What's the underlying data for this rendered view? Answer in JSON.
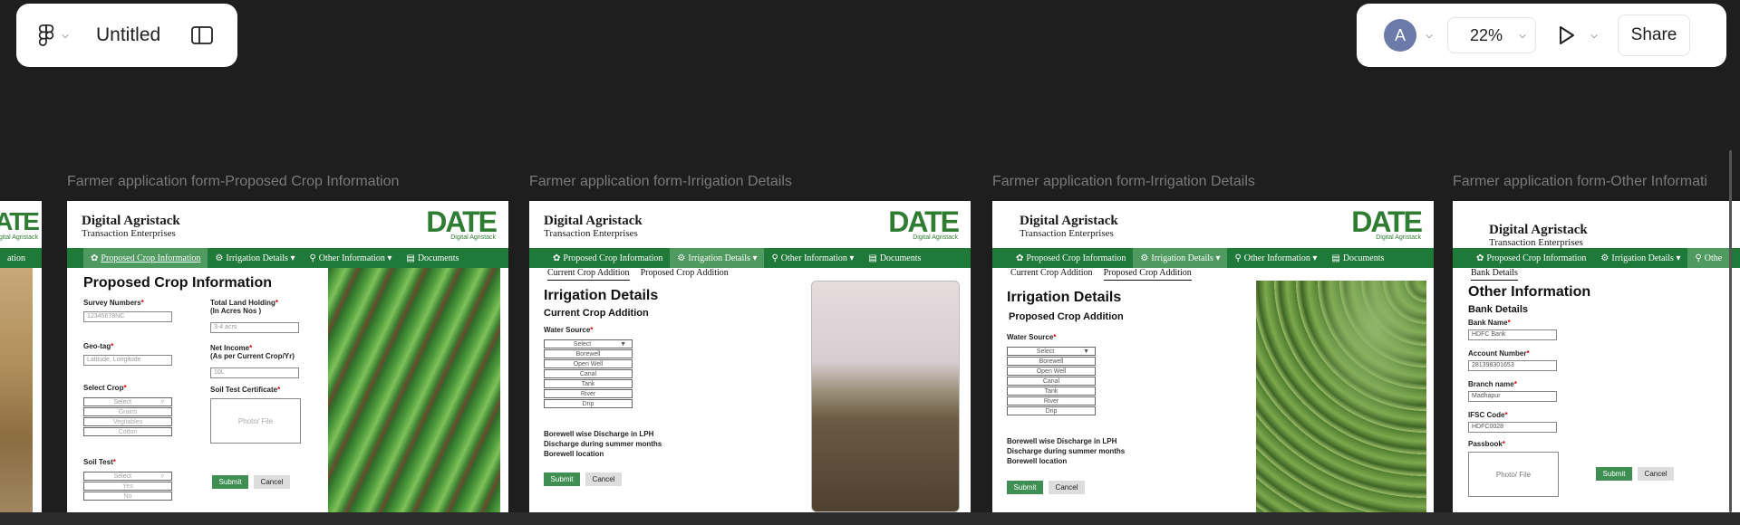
{
  "toolbar": {
    "doc_title": "Untitled",
    "avatar_letter": "A",
    "zoom": "22%",
    "share_label": "Share"
  },
  "frames": [
    {
      "label": "Farmer application form-Proposed Crop Information"
    },
    {
      "label": "Farmer application form-Irrigation Details"
    },
    {
      "label": "Farmer application form-Irrigation Details"
    },
    {
      "label": "Farmer application form-Other Informati"
    }
  ],
  "brand": {
    "name": "Digital Agristack",
    "sub": "Transaction Enterprises",
    "logo": "DATE",
    "logo_sub": "Digital Agristack"
  },
  "nav": {
    "proposed": "Proposed Crop Information",
    "irrigation": "Irrigation Details ▾",
    "other": "Other Information ▾",
    "documents": "Documents",
    "left_edge": "ation"
  },
  "crop": {
    "title": "Proposed Crop Information",
    "survey_label": "Survey Numbers",
    "survey_ph": "12345678NC",
    "land_label": "Total Land Holding",
    "land_label2": "(In Acres Nos )",
    "land_ph": "3-4 acrs",
    "geo_label": "Geo-tag",
    "geo_ph": "Latitude, Longitude",
    "income_label": "Net Income",
    "income_label2": "(As per Current Crop/Yr)",
    "income_ph": "10L",
    "crop_label": "Select Crop",
    "crop_select": "Select",
    "crop_opts": [
      "Grains",
      "Vegitables",
      "Cotton"
    ],
    "cert_label": "Soil Test Certificate",
    "cert_ph": "Photo/ File",
    "soil_label": "Soil Test",
    "soil_select": "Select",
    "soil_opts": [
      "Yes",
      "No"
    ],
    "submit": "Submit",
    "cancel": "Cancel"
  },
  "irr": {
    "tab1": "Current Crop Addition",
    "tab2": "Proposed Crop Addition",
    "title": "Irrigation Details",
    "sub1": "Current Crop Addition",
    "sub2": "Proposed Crop Addition",
    "water_label": "Water Source",
    "select": "Select",
    "opts": [
      "Borewell",
      "Open Well",
      "Canal",
      "Tank",
      "River",
      "Drip"
    ],
    "bw1": "Borewell wise Discharge in LPH",
    "bw2": "Discharge during summer months",
    "bw3": "Borewell location",
    "submit": "Submit",
    "cancel": "Cancel"
  },
  "other": {
    "tab": "Bank Details",
    "title": "Other Information",
    "sub": "Bank Details",
    "bank_label": "Bank Name",
    "bank_val": "HDFC Bank",
    "acct_label": "Account Number",
    "acct_val": "281398301653",
    "branch_label": "Branch name",
    "branch_val": "Madhapur",
    "ifsc_label": "IFSC Code",
    "ifsc_val": "HDFC0028",
    "pass_label": "Passbook",
    "pass_ph": "Photo/ File",
    "submit": "Submit",
    "cancel": "Cancel",
    "nav_other": "Othe"
  },
  "colors": {
    "nav_green": "#1f7a3a",
    "button_green": "#3f8f52",
    "logo_green": "#2f7d32"
  }
}
